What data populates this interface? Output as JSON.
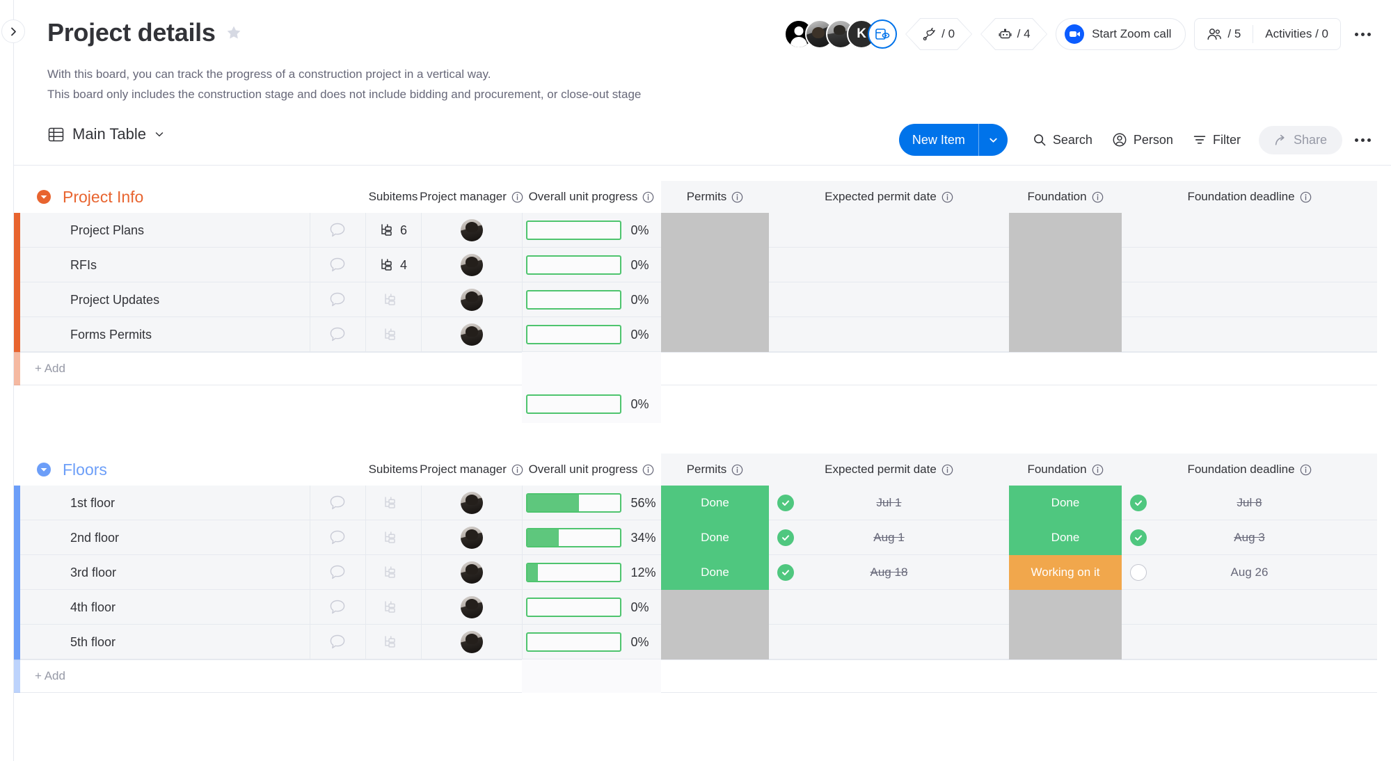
{
  "header": {
    "title": "Project details",
    "star_icon": "star-icon",
    "description_line1": "With this board, you can track the progress of a construction project in a vertical way.",
    "description_line2": "This board only includes the construction stage and does not include bidding and procurement, or close-out stage",
    "avatars": [
      {
        "type": "default-user",
        "initial": ""
      },
      {
        "type": "photo",
        "initial": ""
      },
      {
        "type": "photo",
        "initial": ""
      },
      {
        "type": "initial",
        "initial": "K"
      }
    ],
    "avatar_badge_icon": "board-preview-icon",
    "integrations_label": "/ 0",
    "integrations_icon": "plug-icon",
    "automations_label": "/ 4",
    "automations_icon": "robot-icon",
    "zoom_call_label": "Start Zoom call",
    "zoom_icon": "video-camera-icon",
    "people_count_label": "/ 5",
    "people_icon": "people-icon",
    "activities_label": "Activities / 0",
    "more_icon": "more-options-icon"
  },
  "toolbar": {
    "view_label": "Main Table",
    "view_icon": "table-icon",
    "view_chevron_icon": "chevron-down-icon",
    "new_item_label": "New Item",
    "new_item_chevron_icon": "chevron-down-icon",
    "search_label": "Search",
    "search_icon": "search-icon",
    "person_label": "Person",
    "person_icon": "person-icon",
    "filter_label": "Filter",
    "filter_icon": "filter-icon",
    "share_label": "Share",
    "share_icon": "share-arrow-icon",
    "more_icon": "more-options-icon"
  },
  "columns": {
    "subitems": "Subitems",
    "project_manager": "Project manager",
    "overall_unit_progress": "Overall unit progress",
    "permits": "Permits",
    "expected_permit_date": "Expected permit date",
    "foundation": "Foundation",
    "foundation_deadline": "Foundation deadline",
    "info_icon": "info-icon"
  },
  "colors": {
    "group_project_info": "#e8642f",
    "group_floors": "#6c9ef8",
    "accent_blue": "#0073ea",
    "status_done": "#4fc77f",
    "status_working": "#f1a74c",
    "status_empty": "#c4c4c4",
    "progress_green": "#5ec77d"
  },
  "groups": [
    {
      "name": "Project Info",
      "color": "#e8642f",
      "caret_icon": "caret-down-icon",
      "add_label": "+ Add",
      "summary_progress": 0,
      "summary_progress_label": "0%",
      "rows": [
        {
          "name": "Project Plans",
          "chat_icon": "chat-bubble-icon",
          "subitems": "6",
          "subitems_icon": "subitems-icon",
          "manager_avatar": "avatar",
          "progress": 0,
          "progress_label": "0%",
          "permits_status": "",
          "permits_state": "empty",
          "expected_permit_date": "",
          "expected_permit_check": "none",
          "foundation_status": "",
          "foundation_state": "empty",
          "foundation_deadline": "",
          "foundation_deadline_check": "none"
        },
        {
          "name": "RFIs",
          "chat_icon": "chat-bubble-icon",
          "subitems": "4",
          "subitems_icon": "subitems-icon",
          "manager_avatar": "avatar",
          "progress": 0,
          "progress_label": "0%",
          "permits_status": "",
          "permits_state": "empty",
          "expected_permit_date": "",
          "expected_permit_check": "none",
          "foundation_status": "",
          "foundation_state": "empty",
          "foundation_deadline": "",
          "foundation_deadline_check": "none"
        },
        {
          "name": "Project Updates",
          "chat_icon": "chat-bubble-icon",
          "subitems": "",
          "subitems_icon": "subitems-icon",
          "manager_avatar": "avatar",
          "progress": 0,
          "progress_label": "0%",
          "permits_status": "",
          "permits_state": "empty",
          "expected_permit_date": "",
          "expected_permit_check": "none",
          "foundation_status": "",
          "foundation_state": "empty",
          "foundation_deadline": "",
          "foundation_deadline_check": "none"
        },
        {
          "name": "Forms Permits",
          "chat_icon": "chat-bubble-icon",
          "subitems": "",
          "subitems_icon": "subitems-icon",
          "manager_avatar": "avatar",
          "progress": 0,
          "progress_label": "0%",
          "permits_status": "",
          "permits_state": "empty",
          "expected_permit_date": "",
          "expected_permit_check": "none",
          "foundation_status": "",
          "foundation_state": "empty",
          "foundation_deadline": "",
          "foundation_deadline_check": "none"
        }
      ]
    },
    {
      "name": "Floors",
      "color": "#6c9ef8",
      "caret_icon": "caret-down-icon",
      "add_label": "+ Add",
      "rows": [
        {
          "name": "1st floor",
          "chat_icon": "chat-bubble-icon",
          "subitems": "",
          "subitems_icon": "subitems-icon",
          "manager_avatar": "avatar",
          "progress": 56,
          "progress_label": "56%",
          "permits_status": "Done",
          "permits_state": "done",
          "expected_permit_date": "Jul 1",
          "expected_permit_check": "done",
          "foundation_status": "Done",
          "foundation_state": "done",
          "foundation_deadline": "Jul 8",
          "foundation_deadline_check": "done"
        },
        {
          "name": "2nd floor",
          "chat_icon": "chat-bubble-icon",
          "subitems": "",
          "subitems_icon": "subitems-icon",
          "manager_avatar": "avatar",
          "progress": 34,
          "progress_label": "34%",
          "permits_status": "Done",
          "permits_state": "done",
          "expected_permit_date": "Aug 1",
          "expected_permit_check": "done",
          "foundation_status": "Done",
          "foundation_state": "done",
          "foundation_deadline": "Aug 3",
          "foundation_deadline_check": "done"
        },
        {
          "name": "3rd floor",
          "chat_icon": "chat-bubble-icon",
          "subitems": "",
          "subitems_icon": "subitems-icon",
          "manager_avatar": "avatar",
          "progress": 12,
          "progress_label": "12%",
          "permits_status": "Done",
          "permits_state": "done",
          "expected_permit_date": "Aug 18",
          "expected_permit_check": "done",
          "foundation_status": "Working on it",
          "foundation_state": "working",
          "foundation_deadline": "Aug 26",
          "foundation_deadline_check": "open"
        },
        {
          "name": "4th floor",
          "chat_icon": "chat-bubble-icon",
          "subitems": "",
          "subitems_icon": "subitems-icon",
          "manager_avatar": "avatar",
          "progress": 0,
          "progress_label": "0%",
          "permits_status": "",
          "permits_state": "empty",
          "expected_permit_date": "",
          "expected_permit_check": "none",
          "foundation_status": "",
          "foundation_state": "empty",
          "foundation_deadline": "",
          "foundation_deadline_check": "none"
        },
        {
          "name": "5th floor",
          "chat_icon": "chat-bubble-icon",
          "subitems": "",
          "subitems_icon": "subitems-icon",
          "manager_avatar": "avatar",
          "progress": 0,
          "progress_label": "0%",
          "permits_status": "",
          "permits_state": "empty",
          "expected_permit_date": "",
          "expected_permit_check": "none",
          "foundation_status": "",
          "foundation_state": "empty",
          "foundation_deadline": "",
          "foundation_deadline_check": "none"
        }
      ]
    }
  ]
}
